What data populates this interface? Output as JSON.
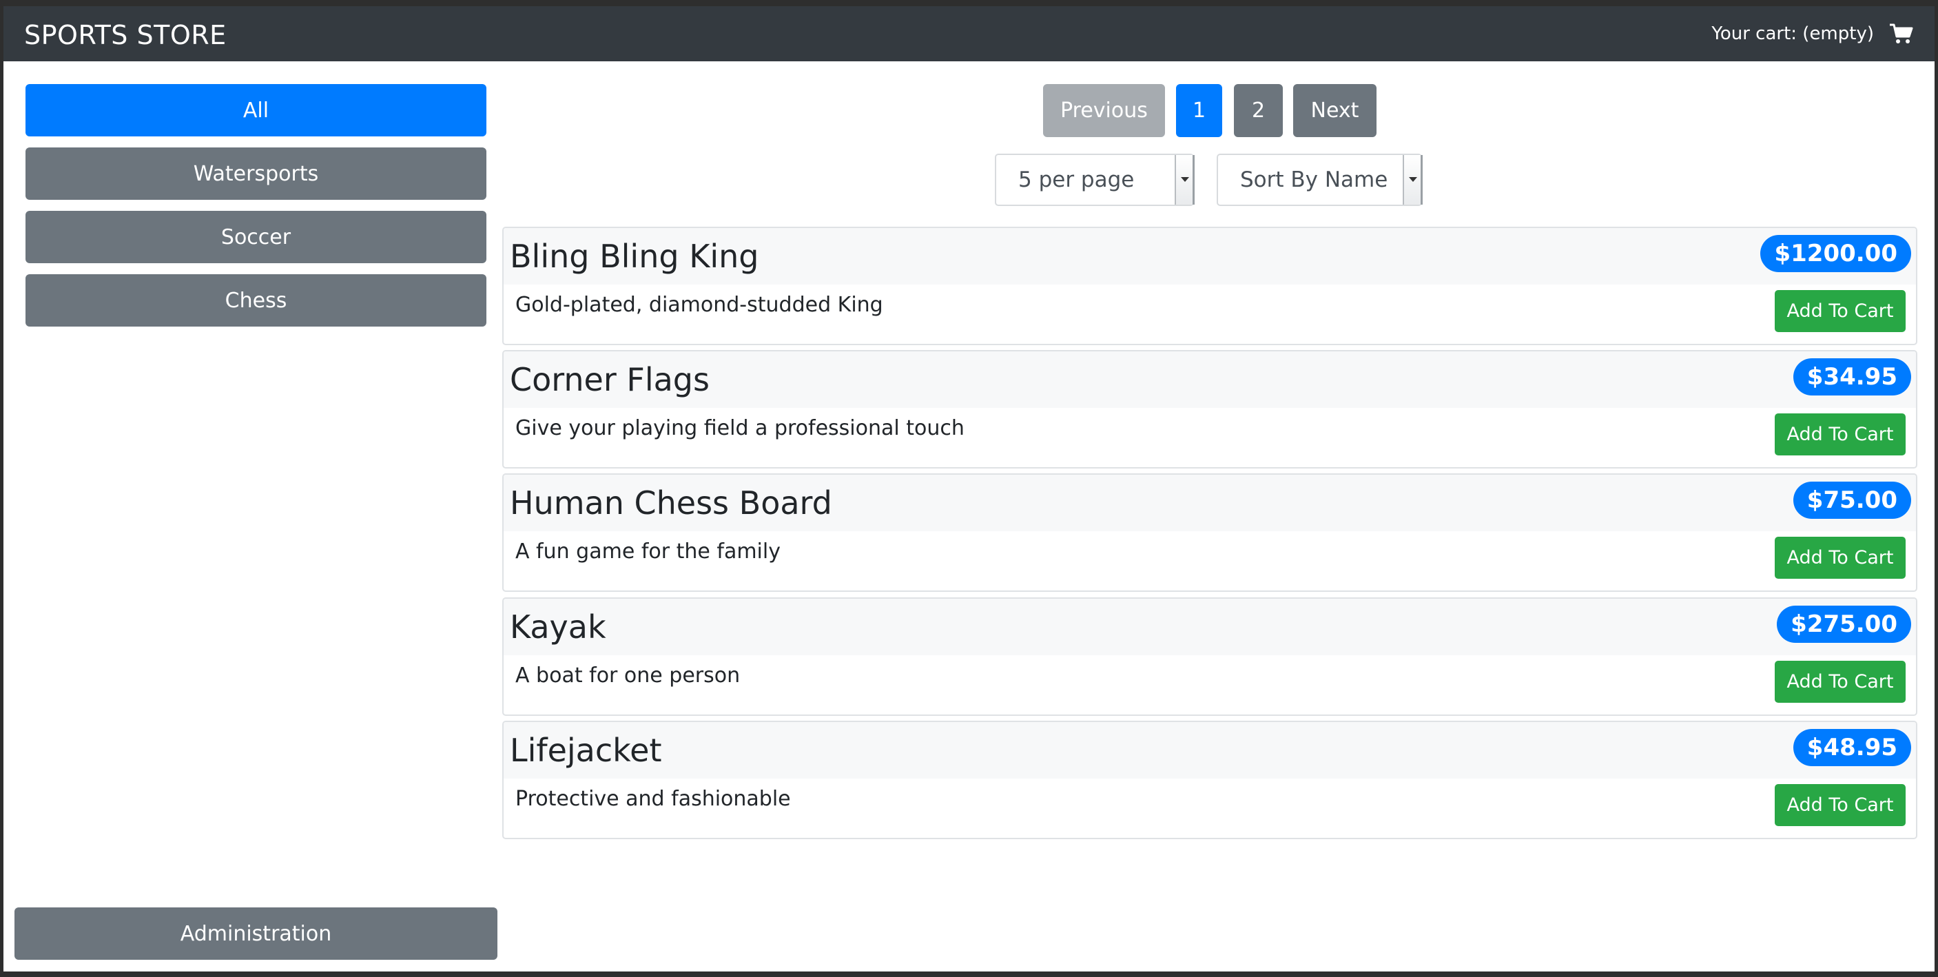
{
  "header": {
    "brand": "SPORTS STORE",
    "cart_summary": "Your cart: (empty)",
    "cart_icon": "shopping-cart-icon"
  },
  "sidebar": {
    "categories": [
      {
        "label": "All",
        "active": true
      },
      {
        "label": "Watersports",
        "active": false
      },
      {
        "label": "Soccer",
        "active": false
      },
      {
        "label": "Chess",
        "active": false
      }
    ],
    "admin_label": "Administration"
  },
  "pagination": {
    "previous_label": "Previous",
    "pages": [
      "1",
      "2"
    ],
    "current_page": "1",
    "next_label": "Next"
  },
  "controls": {
    "per_page": "5 per page",
    "sort": "Sort By Name"
  },
  "products": [
    {
      "name": "Bling Bling King",
      "price": "$1200.00",
      "description": "Gold-plated, diamond-studded King",
      "button": "Add To Cart"
    },
    {
      "name": "Corner Flags",
      "price": "$34.95",
      "description": "Give your playing field a professional touch",
      "button": "Add To Cart"
    },
    {
      "name": "Human Chess Board",
      "price": "$75.00",
      "description": "A fun game for the family",
      "button": "Add To Cart"
    },
    {
      "name": "Kayak",
      "price": "$275.00",
      "description": "A boat for one person",
      "button": "Add To Cart"
    },
    {
      "name": "Lifejacket",
      "price": "$48.95",
      "description": "Protective and fashionable",
      "button": "Add To Cart"
    }
  ],
  "colors": {
    "primary": "#007bff",
    "secondary": "#6c757d",
    "success": "#28a745",
    "navbar": "#343a40"
  }
}
